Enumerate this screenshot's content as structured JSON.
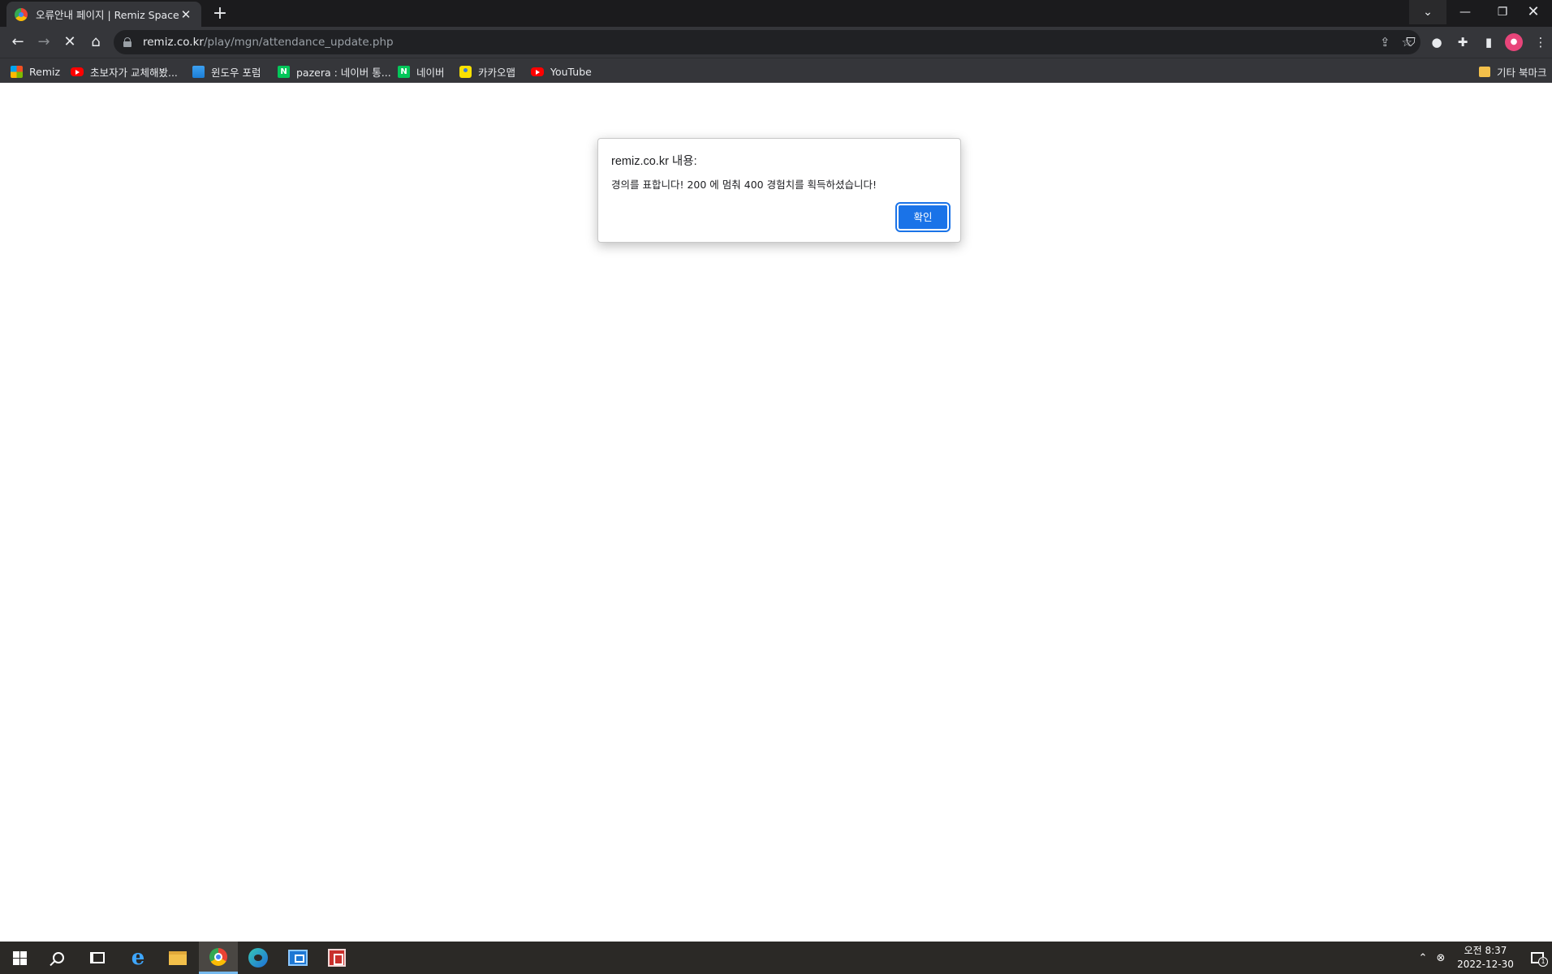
{
  "browser": {
    "tab_title": "오류안내 페이지 | Remiz Space",
    "url_host": "remiz.co.kr",
    "url_path": "/play/mgn/attendance_update.php"
  },
  "bookmarks": [
    {
      "label": "Remiz",
      "icon": "microsoft-logo-icon"
    },
    {
      "label": "초보자가 교체해봤...",
      "icon": "youtube-icon"
    },
    {
      "label": "윈도우 포럼",
      "icon": "windows-forum-icon"
    },
    {
      "label": "pazera : 네이버 통...",
      "icon": "naver-icon"
    },
    {
      "label": "네이버",
      "icon": "naver-icon"
    },
    {
      "label": "카카오맵",
      "icon": "kakaomap-icon"
    },
    {
      "label": "YouTube",
      "icon": "youtube-icon"
    }
  ],
  "other_bookmarks": "기타 북마크",
  "dialog": {
    "title": "remiz.co.kr 내용:",
    "message": "경의를 표합니다! 200 에 멈춰 400 경험치를 획득하셨습니다!",
    "ok_label": "확인"
  },
  "taskbar": {
    "clock_time": "오전 8:37",
    "clock_date": "2022-12-30",
    "notification_count": "1"
  }
}
